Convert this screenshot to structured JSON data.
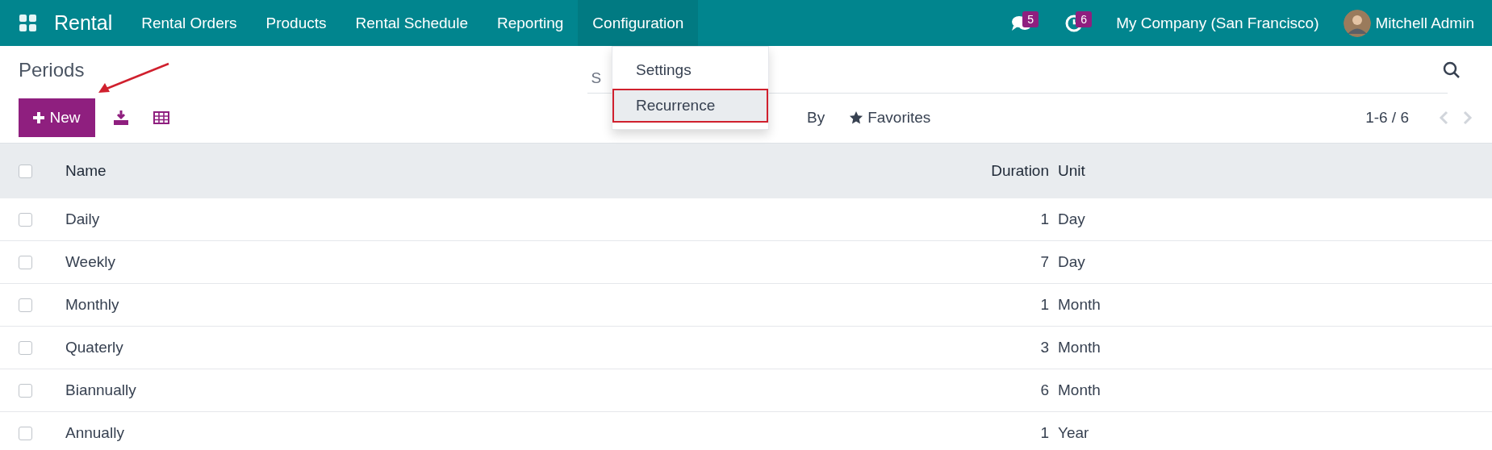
{
  "navbar": {
    "app_name": "Rental",
    "menu": [
      {
        "label": "Rental Orders",
        "selected": false
      },
      {
        "label": "Products",
        "selected": false
      },
      {
        "label": "Rental Schedule",
        "selected": false
      },
      {
        "label": "Reporting",
        "selected": false
      },
      {
        "label": "Configuration",
        "selected": true
      }
    ],
    "messages_badge": "5",
    "activities_badge": "6",
    "company": "My Company (San Francisco)",
    "user": "Mitchell Admin"
  },
  "dropdown": {
    "items": [
      {
        "label": "Settings",
        "selected": false
      },
      {
        "label": "Recurrence",
        "selected": true
      }
    ]
  },
  "control_panel": {
    "title": "Periods",
    "new_button": "New",
    "search_placeholder": "S",
    "group_by": "By",
    "favorites": "Favorites",
    "pager": "1-6 / 6"
  },
  "table": {
    "columns": [
      "Name",
      "Duration",
      "Unit"
    ],
    "header_checked": false,
    "rows": [
      {
        "name": "Daily",
        "duration": "1",
        "unit": "Day",
        "checked": false
      },
      {
        "name": "Weekly",
        "duration": "7",
        "unit": "Day",
        "checked": false
      },
      {
        "name": "Monthly",
        "duration": "1",
        "unit": "Month",
        "checked": false
      },
      {
        "name": "Quaterly",
        "duration": "3",
        "unit": "Month",
        "checked": false
      },
      {
        "name": "Biannually",
        "duration": "6",
        "unit": "Month",
        "checked": false
      },
      {
        "name": "Annually",
        "duration": "1",
        "unit": "Year",
        "checked": false
      }
    ]
  }
}
